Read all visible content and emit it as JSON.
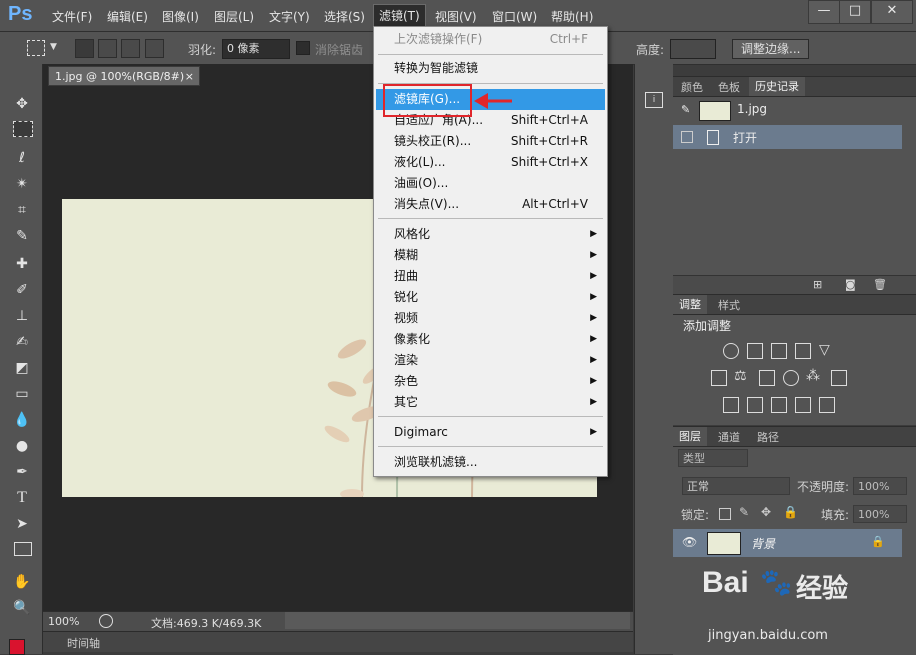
{
  "app": {
    "logo": "Ps"
  },
  "menubar": {
    "items": [
      "文件(F)",
      "编辑(E)",
      "图像(I)",
      "图层(L)",
      "文字(Y)",
      "选择(S)",
      "滤镜(T)",
      "视图(V)",
      "窗口(W)",
      "帮助(H)"
    ],
    "active": "滤镜(T)"
  },
  "window_controls": {
    "minimize": "—",
    "maximize": "□",
    "close": "✕"
  },
  "options": {
    "feather_label": "羽化:",
    "feather_value": "0 像素",
    "antialias_label": "消除锯齿",
    "height_label": "高度:",
    "refine_edge": "调整边缘..."
  },
  "document": {
    "tab_title": "1.jpg @ 100%(RGB/8#)",
    "tab_close": "×",
    "zoom": "100%",
    "doc_size": "文档:469.3 K/469.3K",
    "timeline_label": "时间轴"
  },
  "filter_menu": {
    "items": [
      {
        "label": "上次滤镜操作(F)",
        "shortcut": "Ctrl+F",
        "disabled": true
      },
      {
        "label": "转换为智能滤镜"
      },
      {
        "label": "滤镜库(G)...",
        "highlight": true
      },
      {
        "label": "自适应广角(A)...",
        "shortcut": "Shift+Ctrl+A"
      },
      {
        "label": "镜头校正(R)...",
        "shortcut": "Shift+Ctrl+R"
      },
      {
        "label": "液化(L)...",
        "shortcut": "Shift+Ctrl+X"
      },
      {
        "label": "油画(O)..."
      },
      {
        "label": "消失点(V)...",
        "shortcut": "Alt+Ctrl+V"
      },
      {
        "label": "风格化"
      },
      {
        "label": "模糊"
      },
      {
        "label": "扭曲"
      },
      {
        "label": "锐化"
      },
      {
        "label": "视频"
      },
      {
        "label": "像素化"
      },
      {
        "label": "渲染"
      },
      {
        "label": "杂色"
      },
      {
        "label": "其它"
      },
      {
        "label": "Digimarc"
      },
      {
        "label": "浏览联机滤镜..."
      }
    ],
    "submenu_arrow": "▶"
  },
  "panels": {
    "top_tabs": [
      "颜色",
      "色板",
      "历史记录"
    ],
    "history": {
      "snapshot_name": "1.jpg",
      "step": "打开"
    },
    "adjust_tabs": [
      "调整",
      "样式"
    ],
    "adjust_title": "添加调整",
    "layers_tabs": [
      "图层",
      "通道",
      "路径"
    ],
    "layers": {
      "filter_kind": "类型",
      "blend_mode": "正常",
      "opacity_label": "不透明度:",
      "opacity_value": "100%",
      "lock_label": "锁定:",
      "fill_label": "填充:",
      "fill_value": "100%",
      "layer_name": "背景"
    }
  },
  "watermark": {
    "brand": "Bai",
    "brand2": "经验",
    "url": "jingyan.baidu.com"
  },
  "colors": {
    "accent_highlight": "#3399e6",
    "annotation_red": "#e0262b",
    "foreground_swatch": "#d9132e"
  }
}
